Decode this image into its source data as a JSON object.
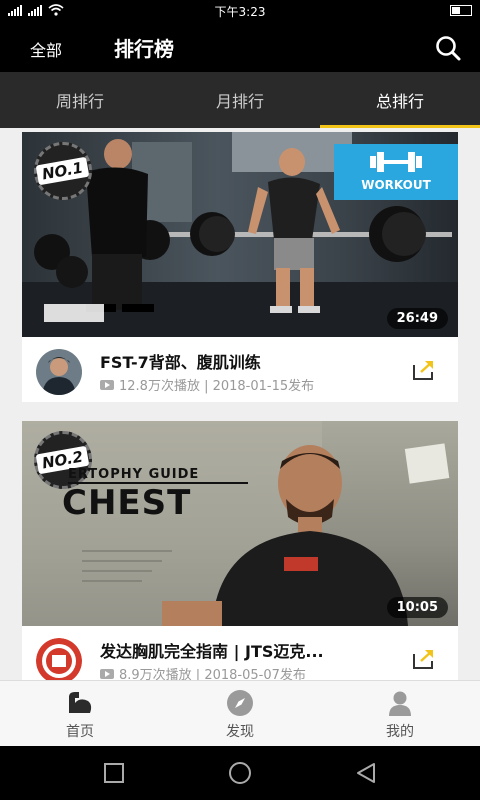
{
  "status_bar": {
    "time": "下午3:23"
  },
  "header": {
    "left_label": "全部",
    "title": "排行榜",
    "search_icon": "search-icon"
  },
  "tabs": [
    {
      "label": "周排行",
      "active": false
    },
    {
      "label": "月排行",
      "active": false
    },
    {
      "label": "总排行",
      "active": true
    }
  ],
  "videos": [
    {
      "rank_label": "NO.1",
      "badge_text": "WORKOUT",
      "duration": "26:49",
      "title": "FST-7背部、腹肌训练",
      "meta": "12.8万次播放 | 2018-01-15发布"
    },
    {
      "rank_label": "NO.2",
      "thumb_subtitle": "ERTOPHY GUIDE",
      "thumb_title": "CHEST",
      "duration": "10:05",
      "title": "发达胸肌完全指南 | JTS迈克...",
      "meta": "8.9万次播放 | 2018-05-07发布"
    }
  ],
  "bottom_nav": [
    {
      "label": "首页",
      "icon": "arm-icon"
    },
    {
      "label": "发现",
      "icon": "compass-icon"
    },
    {
      "label": "我的",
      "icon": "user-icon"
    }
  ],
  "colors": {
    "accent": "#f2c318",
    "header_bg": "#000000",
    "tab_bg": "#2a2a2a",
    "workout_blue": "#2aa7df"
  }
}
